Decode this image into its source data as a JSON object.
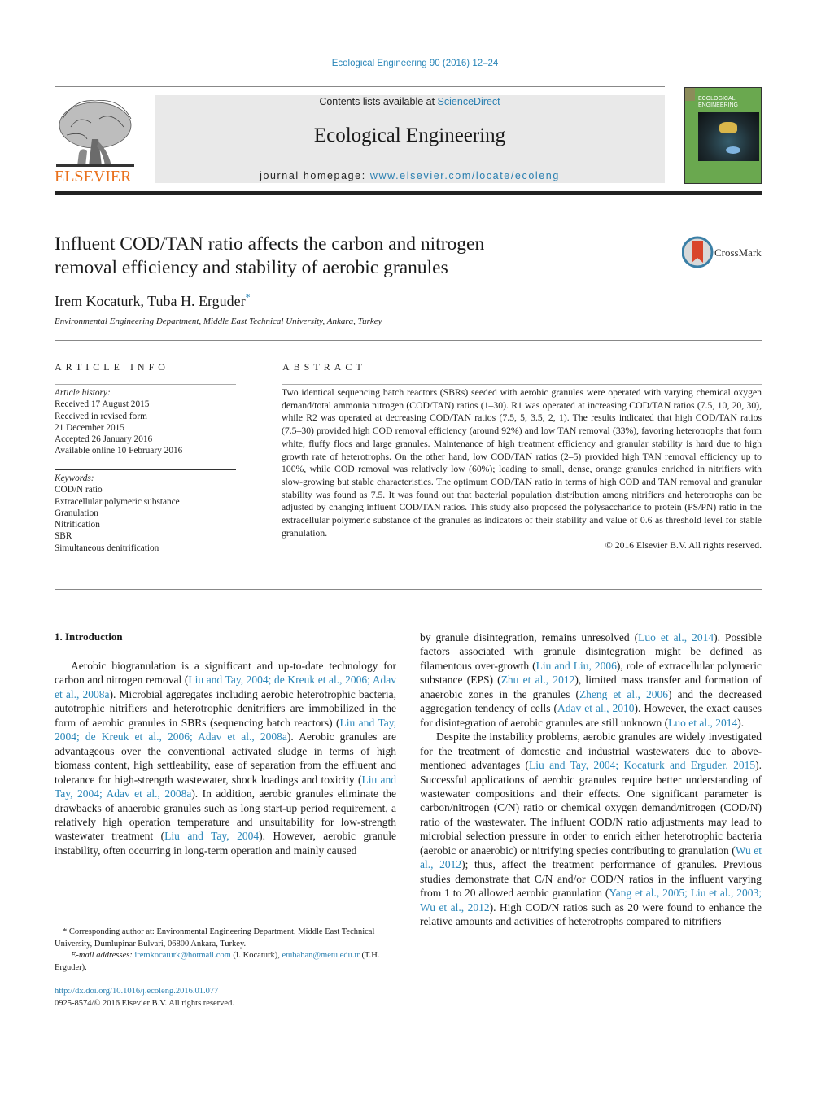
{
  "header": {
    "journal_reference": "Ecological Engineering 90 (2016) 12–24",
    "contents_prefix": "Contents lists available at ",
    "contents_link": "ScienceDirect",
    "journal_title": "Ecological Engineering",
    "homepage_prefix": "journal homepage: ",
    "homepage_link": "www.elsevier.com/locate/ecoleng",
    "publisher_logo": "ELSEVIER",
    "cover_title": "ECOLOGICAL ENGINEERING",
    "colors": {
      "link": "#2a86b8",
      "elsevier_orange": "#e9711c",
      "masthead_bg": "#e9e9e9",
      "cover_green": "#6aa84f"
    }
  },
  "article": {
    "title_line1": "Influent COD/TAN ratio affects the carbon and nitrogen",
    "title_line2": "removal efficiency and stability of aerobic granules",
    "crossmark_label": "CrossMark",
    "authors": "Irem Kocaturk, Tuba H. Erguder",
    "corresponding_mark": "*",
    "affiliation": "Environmental Engineering Department, Middle East Technical University, Ankara, Turkey"
  },
  "article_info": {
    "heading": "ARTICLE INFO",
    "history_label": "Article history:",
    "history": [
      "Received 17 August 2015",
      "Received in revised form",
      "21 December 2015",
      "Accepted 26 January 2016",
      "Available online 10 February 2016"
    ],
    "keywords_label": "Keywords:",
    "keywords": [
      "COD/N ratio",
      "Extracellular polymeric substance",
      "Granulation",
      "Nitrification",
      "SBR",
      "Simultaneous denitrification"
    ]
  },
  "abstract": {
    "heading": "ABSTRACT",
    "text": "Two identical sequencing batch reactors (SBRs) seeded with aerobic granules were operated with varying chemical oxygen demand/total ammonia nitrogen (COD/TAN) ratios (1–30). R1 was operated at increasing COD/TAN ratios (7.5, 10, 20, 30), while R2 was operated at decreasing COD/TAN ratios (7.5, 5, 3.5, 2, 1). The results indicated that high COD/TAN ratios (7.5–30) provided high COD removal efficiency (around 92%) and low TAN removal (33%), favoring heterotrophs that form white, fluffy flocs and large granules. Maintenance of high treatment efficiency and granular stability is hard due to high growth rate of heterotrophs. On the other hand, low COD/TAN ratios (2–5) provided high TAN removal efficiency up to 100%, while COD removal was relatively low (60%); leading to small, dense, orange granules enriched in nitrifiers with slow-growing but stable characteristics. The optimum COD/TAN ratio in terms of high COD and TAN removal and granular stability was found as 7.5. It was found out that bacterial population distribution among nitrifiers and heterotrophs can be adjusted by changing influent COD/TAN ratios. This study also proposed the polysaccharide to protein (PS/PN) ratio in the extracellular polymeric substance of the granules as indicators of their stability and value of 0.6 as threshold level for stable granulation.",
    "copyright": "© 2016 Elsevier B.V. All rights reserved."
  },
  "body": {
    "section_heading": "1.  Introduction",
    "left_column": [
      {
        "t": "Aerobic biogranulation is a significant and up-to-date technology for carbon and nitrogen removal ("
      },
      {
        "c": "Liu and Tay, 2004; de Kreuk et al., 2006; Adav et al., 2008a"
      },
      {
        "t": "). Microbial aggregates including aerobic heterotrophic bacteria, autotrophic nitrifiers and heterotrophic denitrifiers are immobilized in the form of aerobic granules in SBRs (sequencing batch reactors) ("
      },
      {
        "c": "Liu and Tay, 2004; de Kreuk et al., 2006; Adav et al., 2008a"
      },
      {
        "t": "). Aerobic granules are advantageous over the conventional activated sludge in terms of high biomass content, high settleability, ease of separation from the effluent and tolerance for high-strength wastewater, shock loadings and toxicity ("
      },
      {
        "c": "Liu and Tay, 2004; Adav et al., 2008a"
      },
      {
        "t": "). In addition, aerobic granules eliminate the drawbacks of anaerobic granules such as long start-up period requirement, a relatively high operation temperature and unsuitability for low-strength wastewater treatment ("
      },
      {
        "c": "Liu and Tay, 2004"
      },
      {
        "t": "). However, aerobic granule instability, often occurring in long-term operation and mainly caused"
      }
    ],
    "right_column_p1": [
      {
        "t": "by granule disintegration, remains unresolved ("
      },
      {
        "c": "Luo et al., 2014"
      },
      {
        "t": "). Possible factors associated with granule disintegration might be defined as filamentous over-growth ("
      },
      {
        "c": "Liu and Liu, 2006"
      },
      {
        "t": "), role of extracellular polymeric substance (EPS) ("
      },
      {
        "c": "Zhu et al., 2012"
      },
      {
        "t": "), limited mass transfer and formation of anaerobic zones in the granules ("
      },
      {
        "c": "Zheng et al., 2006"
      },
      {
        "t": ") and the decreased aggregation tendency of cells ("
      },
      {
        "c": "Adav et al., 2010"
      },
      {
        "t": "). However, the exact causes for disintegration of aerobic granules are still unknown ("
      },
      {
        "c": "Luo et al., 2014"
      },
      {
        "t": ")."
      }
    ],
    "right_column_p2": [
      {
        "t": "Despite the instability problems, aerobic granules are widely investigated for the treatment of domestic and industrial wastewaters due to above-mentioned advantages ("
      },
      {
        "c": "Liu and Tay, 2004; Kocaturk and Erguder, 2015"
      },
      {
        "t": "). Successful applications of aerobic granules require better understanding of wastewater compositions and their effects. One significant parameter is carbon/nitrogen (C/N) ratio or chemical oxygen demand/nitrogen (COD/N) ratio of the wastewater. The influent COD/N ratio adjustments may lead to microbial selection pressure in order to enrich either heterotrophic bacteria (aerobic or anaerobic) or nitrifying species contributing to granulation ("
      },
      {
        "c": "Wu et al., 2012"
      },
      {
        "t": "); thus, affect the treatment performance of granules. Previous studies demonstrate that C/N and/or COD/N ratios in the influent varying from 1 to 20 allowed aerobic granulation ("
      },
      {
        "c": "Yang et al., 2005; Liu et al., 2003; Wu et al., 2012"
      },
      {
        "t": "). High COD/N ratios such as 20 were found to enhance the relative amounts and activities of heterotrophs compared to nitrifiers"
      }
    ]
  },
  "footnote": {
    "corresponding": "*  Corresponding author at: Environmental Engineering Department, Middle East Technical University, Dumlupinar Bulvari, 06800 Ankara, Turkey.",
    "email_label": "E-mail addresses:",
    "email1": "iremkocaturk@hotmail.com",
    "email1_name": " (I. Kocaturk),",
    "email2": "etubahan@metu.edu.tr",
    "email2_name": " (T.H. Erguder).",
    "doi": "http://dx.doi.org/10.1016/j.ecoleng.2016.01.077",
    "issn_copyright": "0925-8574/© 2016 Elsevier B.V. All rights reserved."
  }
}
